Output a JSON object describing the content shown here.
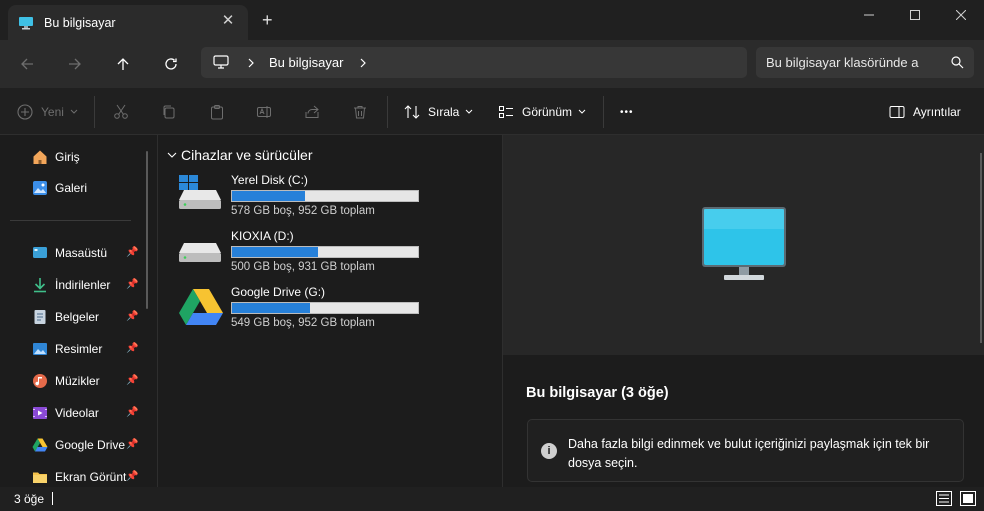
{
  "window": {
    "tab_title": "Bu bilgisayar",
    "tab_close": "✕",
    "new_tab": "+"
  },
  "address": {
    "crumb": "Bu bilgisayar",
    "search_placeholder": "Bu bilgisayar klasöründe a"
  },
  "commands": {
    "new_label": "Yeni",
    "sort_label": "Sırala",
    "view_label": "Görünüm",
    "more_label": "•••",
    "details_label": "Ayrıntılar"
  },
  "sidebar": {
    "top_items": [
      {
        "label": "Giriş",
        "icon": "home-icon"
      },
      {
        "label": "Galeri",
        "icon": "gallery-icon"
      }
    ],
    "pinned_items": [
      {
        "label": "Masaüstü",
        "icon": "desktop-icon"
      },
      {
        "label": "İndirilenler",
        "icon": "downloads-icon"
      },
      {
        "label": "Belgeler",
        "icon": "documents-icon"
      },
      {
        "label": "Resimler",
        "icon": "pictures-icon"
      },
      {
        "label": "Müzikler",
        "icon": "music-icon"
      },
      {
        "label": "Videolar",
        "icon": "videos-icon"
      },
      {
        "label": "Google Drive",
        "icon": "google-drive-icon"
      },
      {
        "label": "Ekran Görüntü",
        "icon": "folder-icon"
      }
    ]
  },
  "main": {
    "group_header": "Cihazlar ve sürücüler",
    "drives": [
      {
        "name": "Yerel Disk (C:)",
        "subtitle": "578 GB boş, 952 GB toplam",
        "used_fraction": 0.39
      },
      {
        "name": "KIOXIA (D:)",
        "subtitle": "500 GB boş, 931 GB toplam",
        "used_fraction": 0.46
      },
      {
        "name": "Google Drive (G:)",
        "subtitle": "549 GB boş, 952 GB toplam",
        "used_fraction": 0.42
      }
    ]
  },
  "details": {
    "title": "Bu bilgisayar (3 öğe)",
    "info_text": "Daha fazla bilgi edinmek ve bulut içeriğinizi paylaşmak için tek bir dosya seçin.",
    "info_icon_glyph": "i"
  },
  "status": {
    "count_text": "3 öğe"
  },
  "colors": {
    "accent": "#2680d9",
    "background": "#1c1c1c"
  }
}
